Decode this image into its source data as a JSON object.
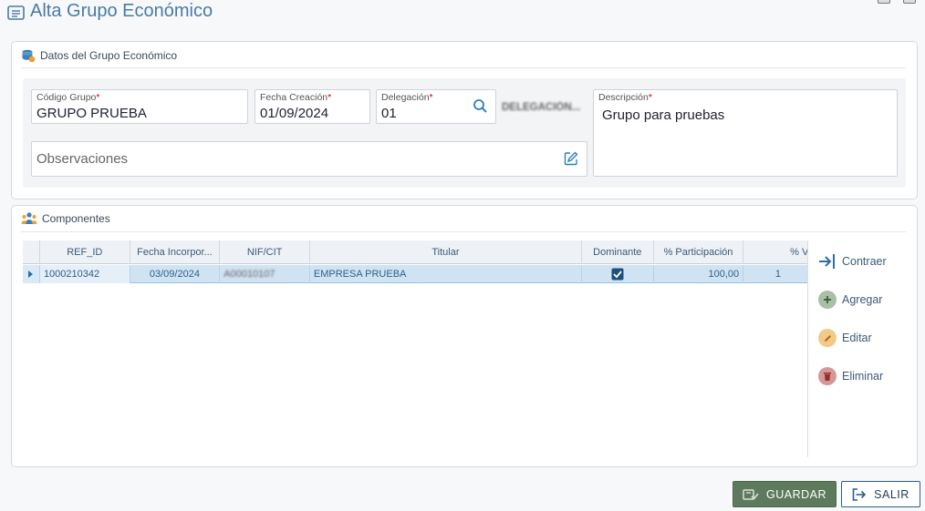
{
  "header": {
    "title": "Alta Grupo Económico",
    "icon": "document-list-icon"
  },
  "datos_panel": {
    "title": "Datos del Grupo Económico",
    "icon": "database-icon",
    "fields": {
      "codigo": {
        "label": "Código Grupo",
        "required": "*",
        "value": "GRUPO PRUEBA"
      },
      "fecha": {
        "label": "Fecha Creación",
        "required": "*",
        "value": "01/09/2024"
      },
      "delegacion": {
        "label": "Delegación",
        "required": "*",
        "value": "01",
        "description": "DELEGACIÓN..."
      },
      "descripcion": {
        "label": "Descripción",
        "required": "*",
        "value": "Grupo para pruebas"
      },
      "observaciones": {
        "placeholder": "Observaciones"
      }
    }
  },
  "componentes_panel": {
    "title": "Componentes",
    "icon": "users-group-icon",
    "columns": [
      "REF_ID",
      "Fecha Incorpor...",
      "NIF/CIT",
      "Titular",
      "Dominante",
      "% Participación",
      "% Voto"
    ],
    "rows": [
      {
        "ref_id": "1000210342",
        "fecha": "03/09/2024",
        "nif": "A00010107",
        "titular": "EMPRESA PRUEBA",
        "dominante": true,
        "participacion": "100,00",
        "voto": "1"
      }
    ],
    "actions": {
      "contraer": "Contraer",
      "agregar": "Agregar",
      "editar": "Editar",
      "eliminar": "Eliminar"
    }
  },
  "footer": {
    "save_label": "GUARDAR",
    "exit_label": "SALIR"
  },
  "colors": {
    "title": "#4a7aa6",
    "save_button": "#5e7a5c",
    "selected_row": "#cfe3f3",
    "agregar": "#9fb59c",
    "editar": "#f0c070",
    "eliminar": "#c98a87"
  }
}
